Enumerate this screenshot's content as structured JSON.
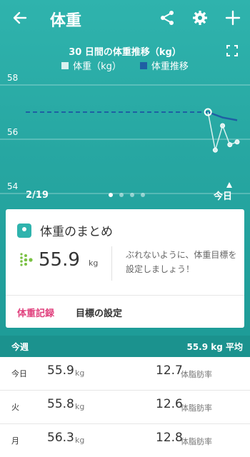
{
  "header": {
    "title": "体重"
  },
  "chart_data": {
    "type": "line",
    "title": "30 日間の体重推移（kg）",
    "legend": [
      "体重（kg）",
      "体重推移"
    ],
    "y_ticks": [
      "58",
      "56",
      "54"
    ],
    "ylim": [
      53.5,
      58.5
    ],
    "x_labels": {
      "start": "2/19",
      "end": "今日"
    },
    "goal_line": 57.0,
    "series": [
      {
        "name": "体重（kg）",
        "x": [
          26,
          27,
          28,
          29,
          30
        ],
        "values": [
          57.0,
          55.6,
          56.5,
          55.8,
          55.9
        ]
      },
      {
        "name": "体重推移",
        "x": [
          1,
          26,
          28,
          30
        ],
        "values": [
          57.0,
          57.0,
          56.8,
          56.7
        ]
      }
    ]
  },
  "summary": {
    "title": "体重のまとめ",
    "value": "55.9",
    "unit": "kg",
    "goal_message": "ぶれないように、体重目標を設定しましょう！",
    "link_log": "体重記録",
    "link_goal": "目標の設定"
  },
  "week": {
    "label": "今週",
    "average": "55.9 kg 平均"
  },
  "rows": [
    {
      "day": "今日",
      "weight": "55.9",
      "unit": "kg",
      "fat": "12.7",
      "fat_unit": "体脂肪率"
    },
    {
      "day": "火",
      "weight": "55.8",
      "unit": "kg",
      "fat": "12.6",
      "fat_unit": "体脂肪率"
    },
    {
      "day": "月",
      "weight": "56.3",
      "unit": "kg",
      "fat": "12.8",
      "fat_unit": "体脂肪率"
    }
  ],
  "colors": {
    "accent": "#2fb3ad",
    "trend": "#1f5fa3",
    "link": "#e0417e"
  }
}
